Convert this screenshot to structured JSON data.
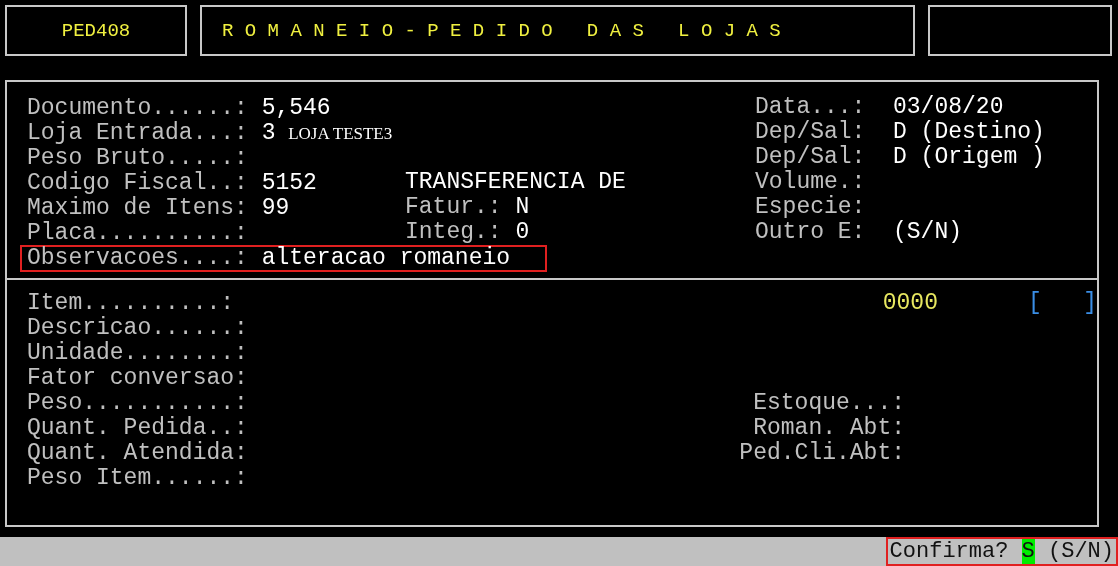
{
  "header": {
    "program_code": "PED408",
    "title": "R O M A N E I O - P E D I D O   D A S   L O J A S"
  },
  "document_panel": {
    "rows": [
      {
        "left": {
          "label": "Documento......:",
          "value": "5,546",
          "highlighted": false
        },
        "middle": null,
        "right": {
          "label": "Data...:",
          "value": "03/08/20"
        }
      },
      {
        "left": {
          "label": "Loja Entrada...:",
          "value": "3",
          "note": "LOJA TESTE3",
          "highlighted": false
        },
        "middle": null,
        "right": {
          "label": "Dep/Sal:",
          "value": "D (Destino)"
        }
      },
      {
        "left": {
          "label": "Peso Bruto.....:",
          "highlighted": false
        },
        "middle": null,
        "right": {
          "label": "Dep/Sal:",
          "value": "D (Origem )"
        }
      },
      {
        "left": {
          "label": "Codigo Fiscal..:",
          "value": "5152",
          "highlighted": false
        },
        "middle": {
          "value": "TRANSFERENCIA DE"
        },
        "right": {
          "label": "Volume.:"
        }
      },
      {
        "left": {
          "label": "Maximo de Itens:",
          "value": "99",
          "highlighted": false
        },
        "middle": {
          "label": "Fatur.:",
          "value": "N"
        },
        "right": {
          "label": "Especie:"
        }
      },
      {
        "left": {
          "label": "Placa..........:",
          "highlighted": false
        },
        "middle": {
          "label": "Integ.:",
          "value": "0"
        },
        "right": {
          "label": "Outro E:",
          "value": "(S/N)"
        }
      },
      {
        "left": {
          "label": "Observacoes....:",
          "value": "alteracao romaneio",
          "highlighted": true
        },
        "middle": null,
        "right": null
      }
    ]
  },
  "item_panel": {
    "item_number": "0000",
    "item_bracket": "[   ]",
    "rows": [
      {
        "label": "Item..........:"
      },
      {
        "label": "Descricao......:"
      },
      {
        "label": "Unidade........:"
      },
      {
        "label": "Fator conversao:"
      },
      {
        "label": "Peso...........:",
        "right_label": "Estoque...:"
      },
      {
        "label": "Quant. Pedida..:",
        "right_label": "Roman. Abt:"
      },
      {
        "label": "Quant. Atendida:",
        "right_label": "Ped.Cli.Abt:"
      },
      {
        "label": "Peso Item......:"
      }
    ]
  },
  "status_bar": {
    "prompt": "Confirma?",
    "answer": "S",
    "options": "(S/N)",
    "highlighted": true
  }
}
